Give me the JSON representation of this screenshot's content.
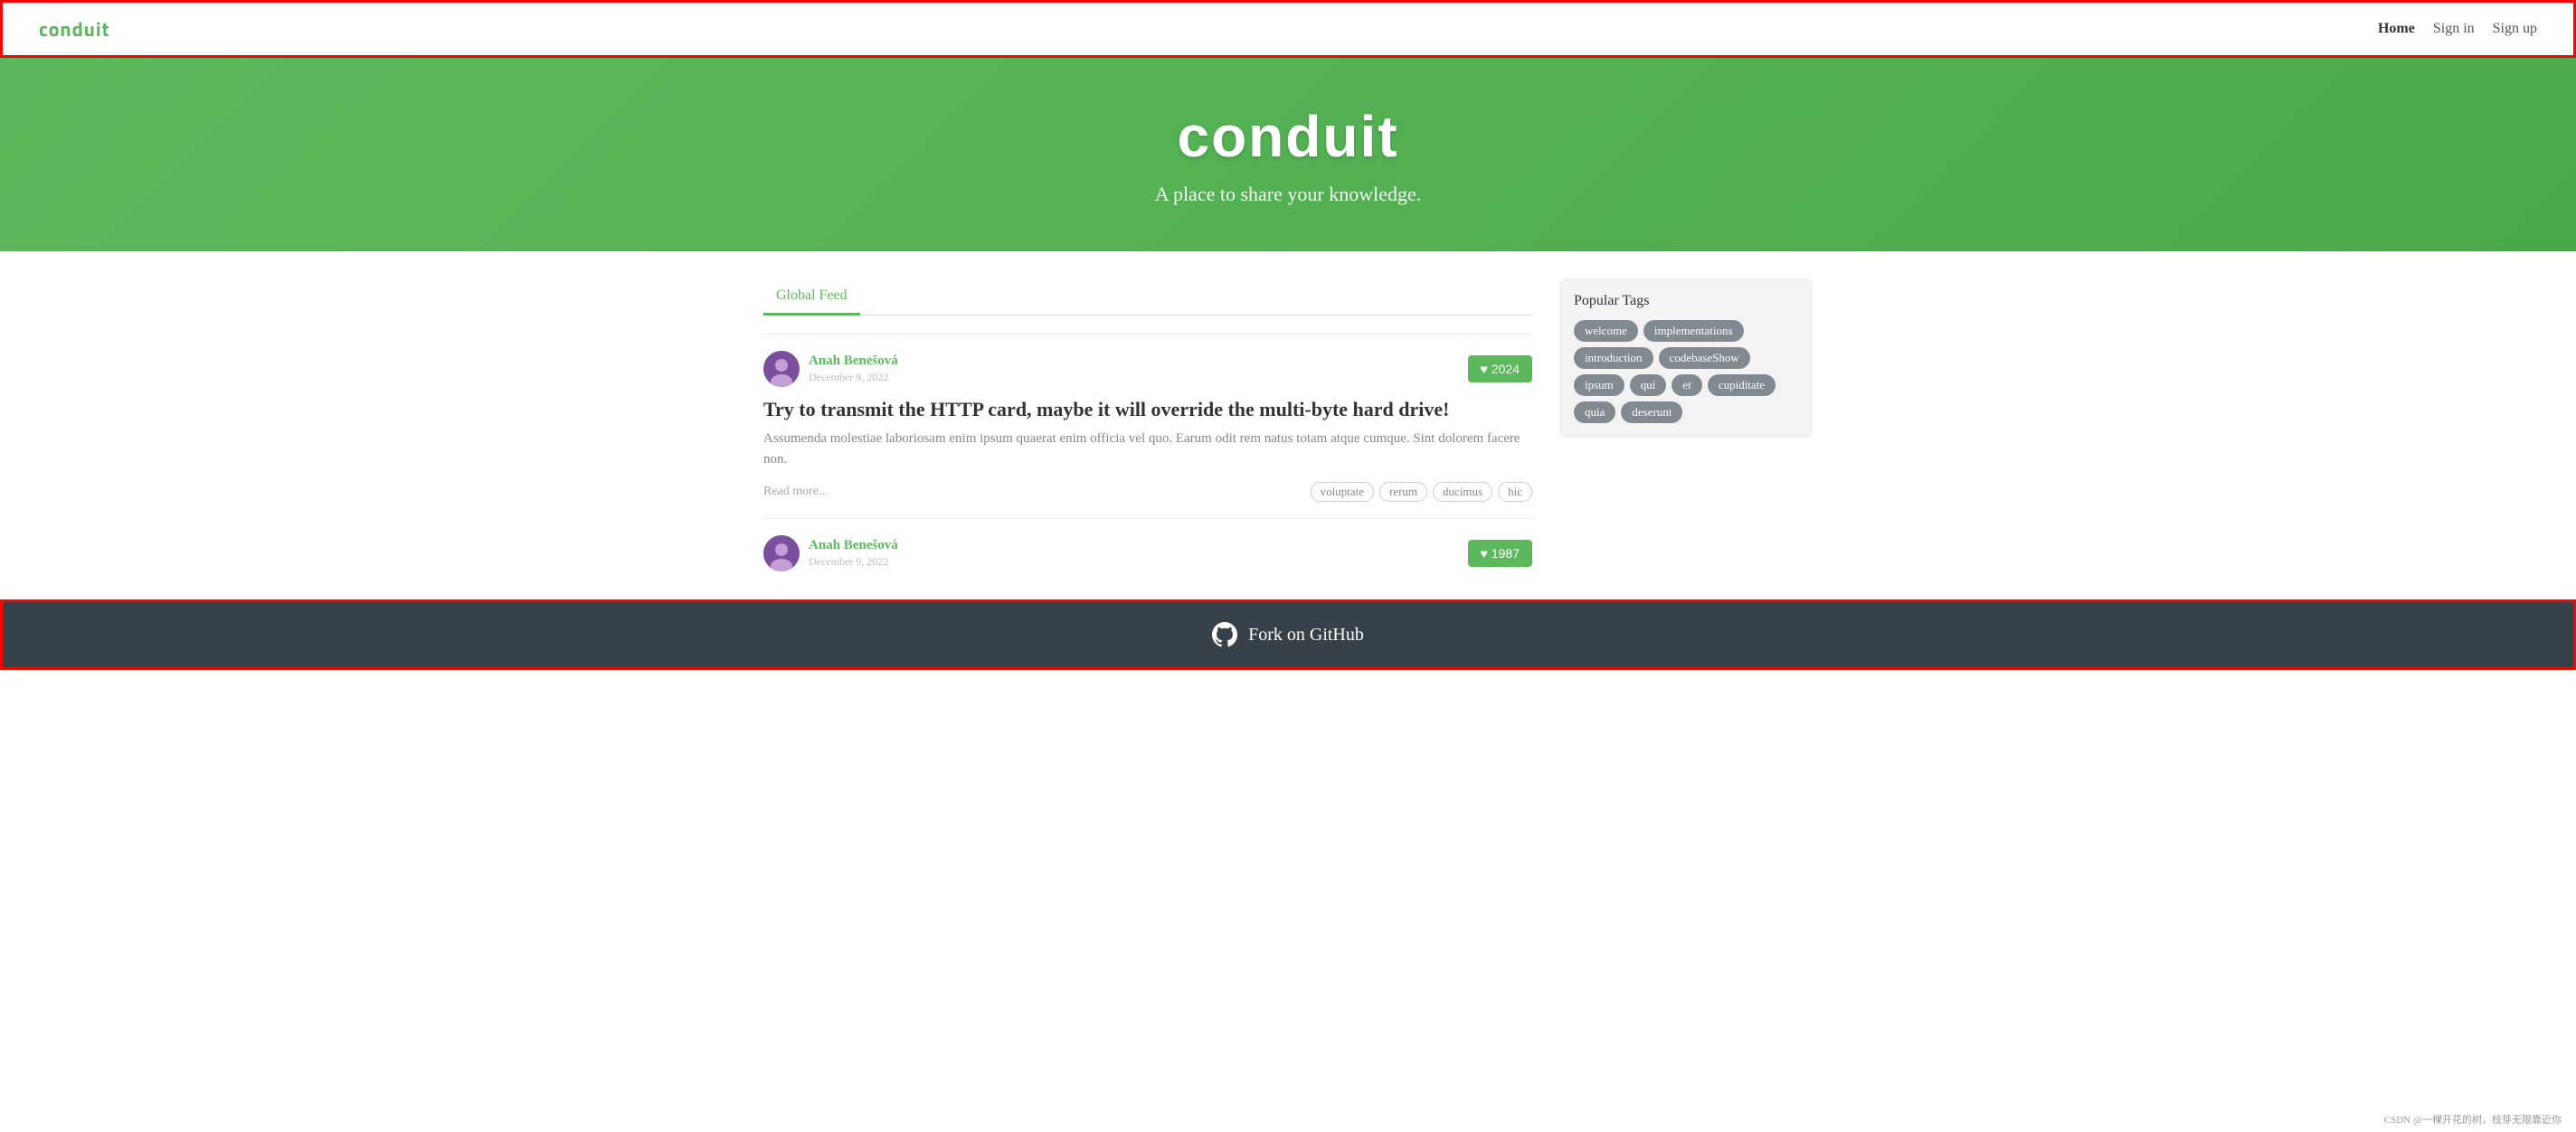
{
  "navbar": {
    "brand": "conduit",
    "nav_items": [
      {
        "label": "Home",
        "active": true,
        "id": "home"
      },
      {
        "label": "Sign in",
        "active": false,
        "id": "signin"
      },
      {
        "label": "Sign up",
        "active": false,
        "id": "signup"
      }
    ]
  },
  "hero": {
    "title": "conduit",
    "subtitle": "A place to share your knowledge."
  },
  "feed": {
    "tab_label": "Global Feed",
    "articles": [
      {
        "id": 1,
        "author": "Anah Benešová",
        "date": "December 9, 2022",
        "likes": 2024,
        "title": "Try to transmit the HTTP card, maybe it will override the multi-byte hard drive!",
        "excerpt": "Assumenda molestiae laboriosam enim ipsum quaerat enim officia vel quo. Earum odit rem natus totam atque cumque. Sint dolorem facere non.",
        "read_more": "Read more...",
        "tags": [
          "voluptate",
          "rerum",
          "ducimus",
          "hic"
        ]
      },
      {
        "id": 2,
        "author": "Anah Benešová",
        "date": "December 9, 2022",
        "likes": 1987,
        "title": "",
        "excerpt": "",
        "read_more": "",
        "tags": []
      }
    ]
  },
  "sidebar": {
    "title": "Popular Tags",
    "tags": [
      "welcome",
      "implementations",
      "introduction",
      "codebaseShow",
      "ipsum",
      "qui",
      "et",
      "cupiditate",
      "quia",
      "deserunt"
    ]
  },
  "footer": {
    "label": "Fork on GitHub"
  },
  "watermark": "CSDN @一棵开花的树，枝芽无限靠近你"
}
